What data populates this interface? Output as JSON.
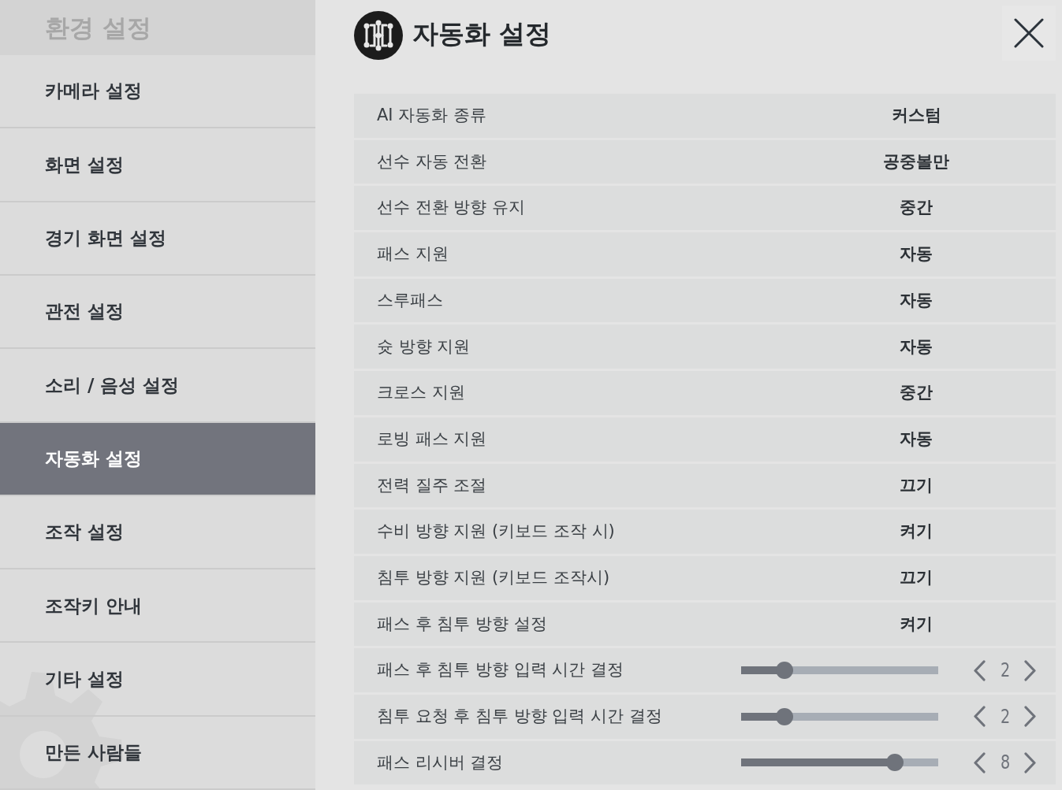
{
  "sidebar": {
    "title": "환경 설정",
    "items": [
      {
        "label": "카메라 설정",
        "selected": false
      },
      {
        "label": "화면 설정",
        "selected": false
      },
      {
        "label": "경기 화면 설정",
        "selected": false
      },
      {
        "label": "관전 설정",
        "selected": false
      },
      {
        "label": "소리 / 음성 설정",
        "selected": false
      },
      {
        "label": "자동화 설정",
        "selected": true
      },
      {
        "label": "조작 설정",
        "selected": false
      },
      {
        "label": "조작키 안내",
        "selected": false
      },
      {
        "label": "기타 설정",
        "selected": false
      },
      {
        "label": "만든 사람들",
        "selected": false
      }
    ]
  },
  "panel": {
    "title": "자동화 설정",
    "settings": [
      {
        "kind": "option",
        "label": "AI 자동화 종류",
        "value": "커스텀"
      },
      {
        "kind": "option",
        "label": "선수 자동 전환",
        "value": "공중볼만"
      },
      {
        "kind": "option",
        "label": "선수 전환 방향 유지",
        "value": "중간"
      },
      {
        "kind": "option",
        "label": "패스 지원",
        "value": "자동"
      },
      {
        "kind": "option",
        "label": "스루패스",
        "value": "자동"
      },
      {
        "kind": "option",
        "label": "슛 방향 지원",
        "value": "자동"
      },
      {
        "kind": "option",
        "label": "크로스 지원",
        "value": "중간"
      },
      {
        "kind": "option",
        "label": "로빙 패스 지원",
        "value": "자동"
      },
      {
        "kind": "option",
        "label": "전력 질주 조절",
        "value": "끄기"
      },
      {
        "kind": "option",
        "label": "수비 방향 지원 (키보드 조작 시)",
        "value": "켜기"
      },
      {
        "kind": "option",
        "label": "침투 방향 지원 (키보드 조작시)",
        "value": "끄기"
      },
      {
        "kind": "option",
        "label": "패스 후 침투 방향 설정",
        "value": "켜기"
      },
      {
        "kind": "slider",
        "label": "패스 후 침투 방향 입력 시간 결정",
        "level": 0.22,
        "value": "2"
      },
      {
        "kind": "slider",
        "label": "침투 요청 후 침투 방향 입력 시간 결정",
        "level": 0.22,
        "value": "2"
      },
      {
        "kind": "slider",
        "label": "패스 리시버 결정",
        "level": 0.78,
        "value": "8"
      }
    ]
  }
}
